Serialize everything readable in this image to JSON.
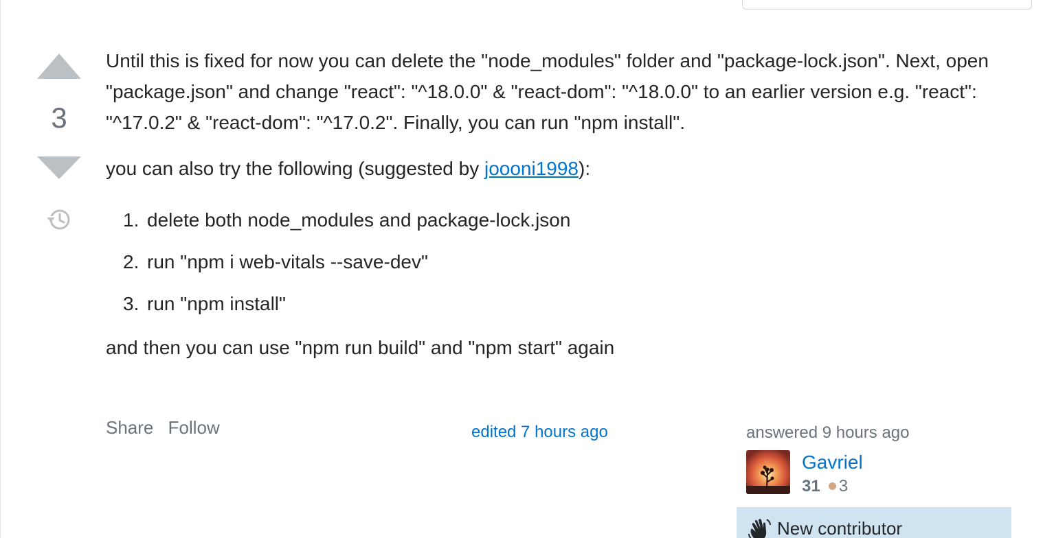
{
  "answer": {
    "vote_count": "3",
    "paragraph1": "Until this is fixed for now you can delete the \"node_modules\" folder and \"package-lock.json\". Next, open \"package.json\" and change \"react\": \"^18.0.0\" & \"react-dom\": \"^18.0.0\" to an earlier version e.g. \"react\": \"^17.0.2\" & \"react-dom\": \"^17.0.2\". Finally, you can run \"npm install\".",
    "paragraph2_before": "you can also try the following (suggested by ",
    "paragraph2_link": "joooni1998",
    "paragraph2_after": "):",
    "steps": [
      {
        "num": "1.",
        "text": "delete both node_modules and package-lock.json"
      },
      {
        "num": "2.",
        "text": "run \"npm i web-vitals --save-dev\""
      },
      {
        "num": "3.",
        "text": "run \"npm install\""
      }
    ],
    "paragraph3": "and then you can use \"npm run build\" and \"npm start\" again"
  },
  "actions": {
    "share_label": "Share",
    "follow_label": "Follow"
  },
  "edited": {
    "label": "edited 7 hours ago"
  },
  "user_card": {
    "answered": "answered 9 hours ago",
    "username": "Gavriel",
    "reputation": "31",
    "bronze_badges": "3",
    "new_contributor": "New contributor"
  },
  "icons": {
    "history": "history-icon",
    "wave": "wave-hand-icon"
  },
  "colors": {
    "link": "#0074cc",
    "muted": "#6a737c",
    "vote_arrow": "#bbc0c4",
    "bronze": "#d1a684",
    "new_contributor_bg": "#d0e3f1"
  }
}
